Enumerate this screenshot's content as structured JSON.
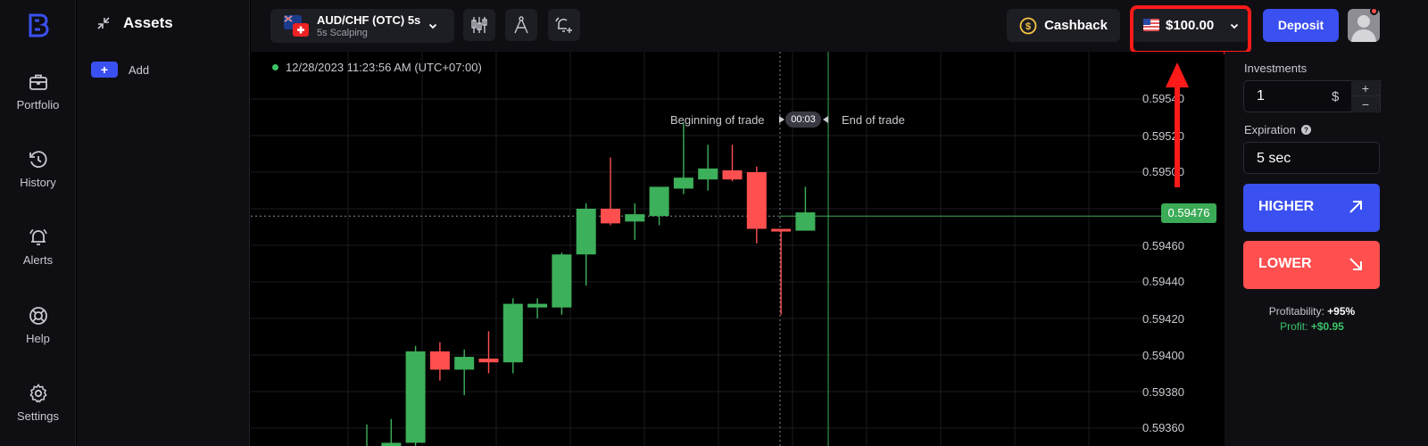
{
  "colors": {
    "accent": "#3b50f0",
    "up_candle": "#3cb05a",
    "down_candle": "#ff4f4f",
    "highlight": "#ff1a1a",
    "profit": "#3cc36a"
  },
  "sidebar": {
    "items": [
      {
        "label": "Portfolio",
        "icon": "briefcase-icon"
      },
      {
        "label": "History",
        "icon": "history-icon"
      },
      {
        "label": "Alerts",
        "icon": "bell-icon"
      },
      {
        "label": "Help",
        "icon": "lifebuoy-icon"
      },
      {
        "label": "Settings",
        "icon": "gear-icon"
      }
    ]
  },
  "assets_panel": {
    "title": "Assets",
    "add_label": "Add",
    "add_button": "+"
  },
  "topbar": {
    "asset_name": "AUD/CHF (OTC) 5s",
    "asset_sub": "5s Scalping",
    "cashback_label": "Cashback",
    "balance": "$100.00",
    "deposit_label": "Deposit"
  },
  "chart": {
    "timestamp": "12/28/2023  11:23:56 AM  (UTC+07:00)",
    "beginning_label": "Beginning of trade",
    "end_label": "End of trade",
    "timer": "00:03",
    "current_price": "0.59476",
    "price_ticks": [
      "0.59540",
      "0.59520",
      "0.59500",
      "0.59460",
      "0.59440",
      "0.59420",
      "0.59400",
      "0.59380",
      "0.59360"
    ]
  },
  "chart_data": {
    "type": "candlestick",
    "y_range": [
      0.5935,
      0.5956
    ],
    "current_price": 0.59476,
    "candles": [
      {
        "o": 0.59348,
        "h": 0.59362,
        "l": 0.5934,
        "c": 0.5935,
        "color": "up"
      },
      {
        "o": 0.5935,
        "h": 0.59365,
        "l": 0.59345,
        "c": 0.59352,
        "color": "up"
      },
      {
        "o": 0.59352,
        "h": 0.59405,
        "l": 0.5935,
        "c": 0.59402,
        "color": "up"
      },
      {
        "o": 0.59402,
        "h": 0.59407,
        "l": 0.59386,
        "c": 0.59392,
        "color": "down"
      },
      {
        "o": 0.59392,
        "h": 0.59403,
        "l": 0.59378,
        "c": 0.59399,
        "color": "up"
      },
      {
        "o": 0.59398,
        "h": 0.59413,
        "l": 0.5939,
        "c": 0.59396,
        "color": "down"
      },
      {
        "o": 0.59396,
        "h": 0.59431,
        "l": 0.5939,
        "c": 0.59428,
        "color": "up"
      },
      {
        "o": 0.59428,
        "h": 0.59431,
        "l": 0.5942,
        "c": 0.59426,
        "color": "up"
      },
      {
        "o": 0.59426,
        "h": 0.59456,
        "l": 0.59422,
        "c": 0.59455,
        "color": "up"
      },
      {
        "o": 0.59455,
        "h": 0.59483,
        "l": 0.59438,
        "c": 0.5948,
        "color": "up"
      },
      {
        "o": 0.5948,
        "h": 0.59508,
        "l": 0.59471,
        "c": 0.59472,
        "color": "down"
      },
      {
        "o": 0.59473,
        "h": 0.59483,
        "l": 0.59463,
        "c": 0.59477,
        "color": "up"
      },
      {
        "o": 0.59476,
        "h": 0.59489,
        "l": 0.59471,
        "c": 0.59492,
        "color": "up"
      },
      {
        "o": 0.59491,
        "h": 0.59527,
        "l": 0.59488,
        "c": 0.59497,
        "color": "up"
      },
      {
        "o": 0.59496,
        "h": 0.59515,
        "l": 0.5949,
        "c": 0.59502,
        "color": "up"
      },
      {
        "o": 0.59501,
        "h": 0.59515,
        "l": 0.59495,
        "c": 0.59496,
        "color": "down"
      },
      {
        "o": 0.595,
        "h": 0.59503,
        "l": 0.59461,
        "c": 0.59469,
        "color": "down"
      },
      {
        "o": 0.59468,
        "h": 0.59469,
        "l": 0.59422,
        "c": 0.59469,
        "color": "down"
      },
      {
        "o": 0.59468,
        "h": 0.59492,
        "l": 0.59468,
        "c": 0.59478,
        "color": "up"
      }
    ]
  },
  "trade_panel": {
    "investments_label": "Investments",
    "investment_value": "1",
    "currency": "$",
    "plus": "+",
    "minus": "−",
    "expiration_label": "Expiration",
    "expiration_value": "5 sec",
    "higher_label": "HIGHER",
    "lower_label": "LOWER",
    "profitability_label": "Profitability:",
    "profitability_value": "+95%",
    "profit_label": "Profit:",
    "profit_value": "+$0.95"
  }
}
